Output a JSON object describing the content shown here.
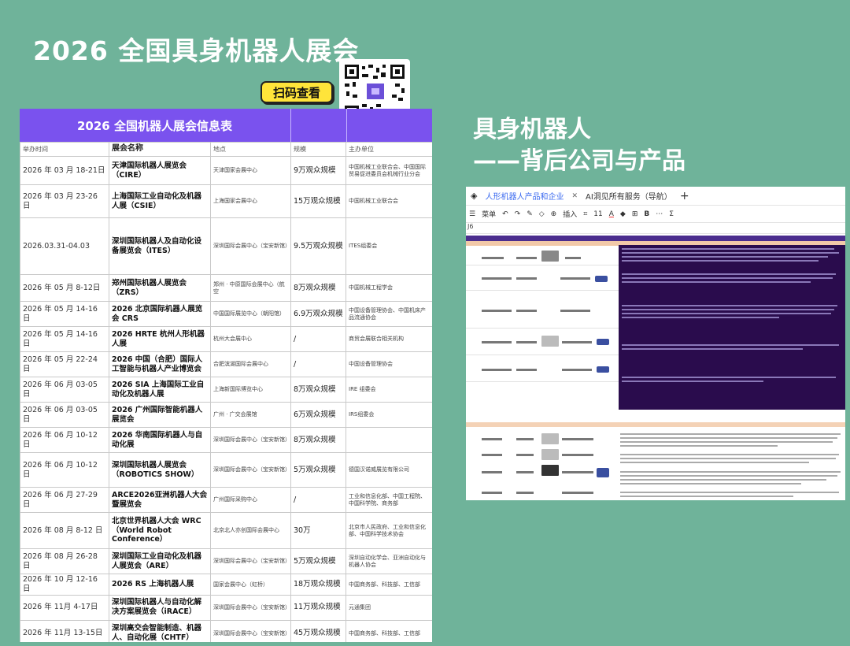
{
  "main_title": "2026 全国具身机器人展会",
  "scan_label": "扫码查看",
  "table": {
    "title": "2026 全国机器人展会信息表",
    "headers": [
      "举办时间",
      "展会名称",
      "地点",
      "规模",
      "主办单位"
    ],
    "rows": [
      {
        "date": "2026 年 03 月 18-21日",
        "name": "天津国际机器人展览会（CIRE）",
        "venue": "天津国家会展中心",
        "scale": "9万观众规模",
        "host": "中国机械工业联合会、中国国际贸易促进委员会机械行业分会"
      },
      {
        "date": "2026 年 03 月 23-26 日",
        "name": "上海国际工业自动化及机器人展（CSIE）",
        "venue": "上海国家会展中心",
        "scale": "15万观众规模",
        "host": "中国机械工业联合会"
      },
      {
        "date": "2026.03.31-04.03",
        "name": "深圳国际机器人及自动化设备展览会（ITES）",
        "venue": "深圳国际会展中心（宝安新馆）",
        "scale": "9.5万观众规模",
        "host": "ITES组委会"
      },
      {
        "date": "2026 年 05 月 8-12日",
        "name": "郑州国际机器人展览会（ZRS）",
        "venue": "郑州 · 中原国际会展中心（航空",
        "scale": "8万观众规模",
        "host": "中国机械工程学会"
      },
      {
        "date": "2026 年 05 月 14-16 日",
        "name": "2026 北京国际机器人展览会 CRS",
        "venue": "中国国际展览中心（朝阳馆）",
        "scale": "6.9万观众规模",
        "host": "中国设备管理协会、中国机床产品流通协会"
      },
      {
        "date": "2026 年 05 月 14-16 日",
        "name": "2026 HRTE 杭州人形机器人展",
        "venue": "杭州大会展中心",
        "scale": "/",
        "host": "商贸会展联合相关机构"
      },
      {
        "date": "2026 年 05 月 22-24 日",
        "name": "2026 中国（合肥）国际人工智能与机器人产业博览会",
        "venue": "合肥滨湖国际会展中心",
        "scale": "/",
        "host": "中国设备管理协会"
      },
      {
        "date": "2026 年 06 月 03-05 日",
        "name": "2026 SIA 上海国际工业自动化及机器人展",
        "venue": "上海新国际博览中心",
        "scale": "8万观众规模",
        "host": "IRE 组委会"
      },
      {
        "date": "2026 年 06 月 03-05 日",
        "name": "2026 广州国际智能机器人展览会",
        "venue": "广州 · 广交会展馆",
        "scale": "6万观众规模",
        "host": "IRS组委会"
      },
      {
        "date": "2026 年 06 月 10-12 日",
        "name": "2026 华南国际机器人与自动化展",
        "venue": "深圳国际会展中心（宝安新馆）",
        "scale": "8万观众规模",
        "host": ""
      },
      {
        "date": "2026 年 06 月 10-12 日",
        "name": "深圳国际机器人展览会（ROBOTICS SHOW）",
        "venue": "深圳国际会展中心（宝安新馆）",
        "scale": "5万观众规模",
        "host": "德国汉诺威展览有限公司"
      },
      {
        "date": "2026 年 06 月 27-29 日",
        "name": "ARCE2026亚洲机器人大会暨展览会",
        "venue": "广州国际采购中心",
        "scale": "/",
        "host": "工业和信息化部、中国工程院、中国科学院、商务部"
      },
      {
        "date": "2026 年 08 月 8-12 日",
        "name": "北京世界机器人大会 WRC（World Robot Conference）",
        "venue": "北京北人亦创国际会展中心",
        "scale": "30万",
        "host": "北京市人民政府、工业和信息化部、中国科学技术协会"
      },
      {
        "date": "2026 年 08 月 26-28 日",
        "name": "深圳国际工业自动化及机器人展览会（ARE）",
        "venue": "深圳国际会展中心（宝安新馆）",
        "scale": "5万观众规模",
        "host": "深圳自动化学会、亚洲自动化与机器人协会"
      },
      {
        "date": "2026 年 10 月 12-16 日",
        "name": "2026 RS 上海机器人展",
        "venue": "国家会展中心（虹桥）",
        "scale": "18万观众规模",
        "host": "中国商务部、科技部、工信部"
      },
      {
        "date": "2026 年 11月 4-17日",
        "name": "深圳国际机器人与自动化解决方案展览会（iRACE）",
        "venue": "深圳国际会展中心（宝安新馆）",
        "scale": "11万观众规模",
        "host": "元通集团"
      },
      {
        "date": "2026 年 11月 13-15日",
        "name": "深圳高交会智能制造、机器人、自动化展（CHTF）",
        "venue": "深圳国际会展中心（宝安新馆）",
        "scale": "45万观众规模",
        "host": "中国商务部、科技部、工信部"
      }
    ]
  },
  "right_title_line1": "具身机器人",
  "right_title_line2": "——背后公司与产品",
  "sheet": {
    "tabs": [
      "人形机器人产品和企业",
      "AI洞见所有服务（导航）"
    ],
    "add_tab": "+",
    "toolbar": {
      "menu": "菜单",
      "insert": "插入",
      "font_size": "11"
    },
    "cell_ref": "J6"
  },
  "colors": {
    "background": "#6fb39a",
    "table_header": "#7a52ee",
    "sheet_dark": "#2a0c4d",
    "badge": "#ffe43a"
  }
}
